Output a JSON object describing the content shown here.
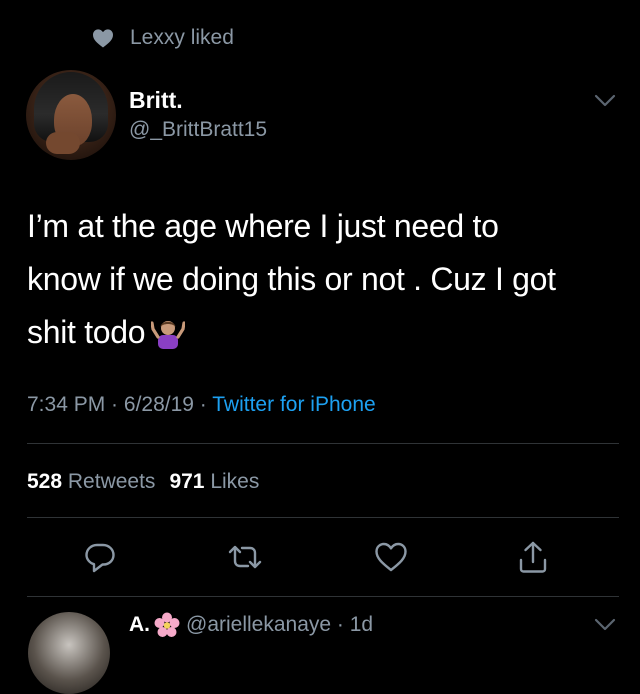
{
  "social_context": {
    "icon": "heart-filled-icon",
    "text": "Lexxy liked"
  },
  "author": {
    "name": "Britt.",
    "handle": "@_BrittBratt15"
  },
  "tweet": {
    "line1": "I’m at the age where I just need to",
    "line2": "know if we doing this or not . Cuz I got",
    "line3": "shit todo",
    "emoji": "person-shrugging-emoji"
  },
  "meta": {
    "time": "7:34 PM",
    "sep1": " · ",
    "date": "6/28/19",
    "sep2": " · ",
    "source": "Twitter for iPhone"
  },
  "stats": {
    "retweets_count": "528",
    "retweets_label": "Retweets",
    "likes_count": "971",
    "likes_label": "Likes"
  },
  "actions": [
    "reply-icon",
    "retweet-icon",
    "like-icon",
    "share-icon"
  ],
  "next_tweet": {
    "name": "A.",
    "emoji": "cherry-blossom-emoji",
    "handle": "@ariellekanaye · 1d"
  },
  "colors": {
    "background": "#000000",
    "primary_text": "#ffffff",
    "secondary_text": "#8b98a5",
    "link": "#1da1f2",
    "divider": "#2f3336"
  }
}
